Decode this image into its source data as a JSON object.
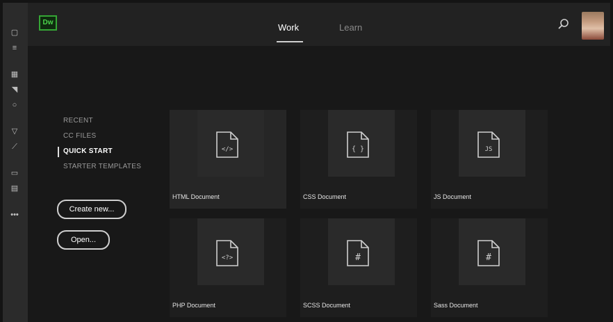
{
  "header": {
    "app_logo": "Dw",
    "tabs": [
      {
        "label": "Work",
        "active": true
      },
      {
        "label": "Learn",
        "active": false
      }
    ]
  },
  "sidebar": {
    "items": [
      {
        "label": "RECENT",
        "active": false
      },
      {
        "label": "CC FILES",
        "active": false
      },
      {
        "label": "QUICK START",
        "active": true
      },
      {
        "label": "STARTER TEMPLATES",
        "active": false
      }
    ]
  },
  "actions": {
    "create_new": "Create new...",
    "open": "Open..."
  },
  "cards": [
    {
      "label": "HTML Document",
      "icon_text": "</>"
    },
    {
      "label": "CSS Document",
      "icon_text": "{ }"
    },
    {
      "label": "JS Document",
      "icon_text": "JS"
    },
    {
      "label": "PHP Document",
      "icon_text": "<?>"
    },
    {
      "label": "SCSS Document",
      "icon_text": "#"
    },
    {
      "label": "Sass Document",
      "icon_text": "#"
    }
  ],
  "colors": {
    "brand_green": "#35a635",
    "background": "#141414"
  }
}
